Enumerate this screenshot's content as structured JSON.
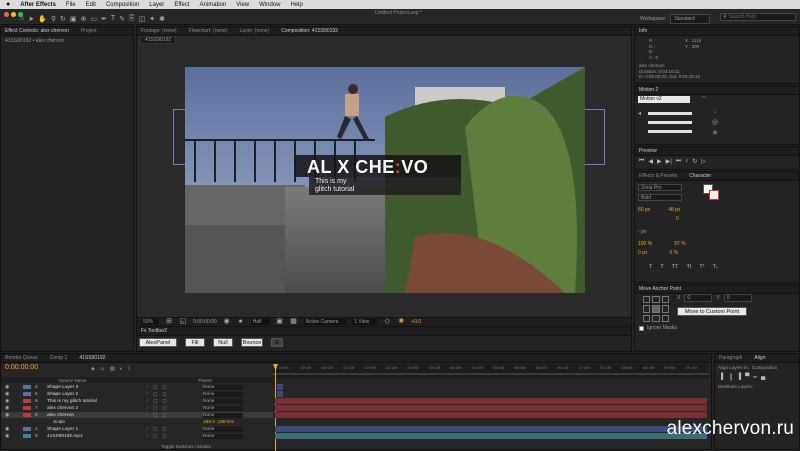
{
  "menubar": {
    "apple": "",
    "app": "After Effects",
    "items": [
      "File",
      "Edit",
      "Composition",
      "Layer",
      "Effect",
      "Animation",
      "View",
      "Window",
      "Help"
    ],
    "doc_title": "Untitled Project.aep *"
  },
  "toolbar": {
    "workspace_label": "Workspace:",
    "workspace_value": "Standard",
    "search_placeholder": "Search Help"
  },
  "project_panel": {
    "tabs": [
      "Effect Controls: alex chervon",
      "Project"
    ],
    "subtitle": "41SS90192 • alex chervon"
  },
  "viewer_tabs": [
    "Footage: (none)",
    "Flowchart: (none)",
    "Layer: (none)",
    "Composition: 41SS90192"
  ],
  "comp_tab_label": "41SS90192",
  "title_card": {
    "headline_a": "AL",
    "headline_b": "X CHE",
    "headline_c": "VO",
    "sub1": "This is my",
    "sub2": "glitch tutorial"
  },
  "viewer_bar": {
    "zoom": "50%",
    "timecode": "0:00:00:00",
    "resolution": "Half",
    "camera": "Active Camera",
    "views": "1 View",
    "exposure": "+0.0"
  },
  "fxtoolbar": {
    "title": "Fx Toolbar2",
    "buttons": [
      "AlexPanel",
      "Fill",
      "Null",
      "Bounce"
    ]
  },
  "info_panel": {
    "tab": "Info",
    "rgb": [
      "R :",
      "G :",
      "B :",
      "A : 0"
    ],
    "xy": [
      "X : 1116",
      "Y : 308"
    ],
    "layer": "alex chervon",
    "duration": "Duration: 0:03:10:11",
    "inout": "In: 0:00:00:00, Out: 0:03:10:10"
  },
  "motion_panel": {
    "tab": "Motion 2",
    "dropdown": "Motion v2"
  },
  "preview_panel": {
    "tab": "Preview"
  },
  "char_panel": {
    "tabs": [
      "Effects & Presets",
      "Character"
    ],
    "font": "Zona Pro",
    "style": "Bold",
    "size": "60 px",
    "leading": "Auto",
    "kerning": "",
    "tracking": "0",
    "stroke": "- px",
    "vscale": "100 %",
    "hscale": "97 %",
    "baseline": "0 px",
    "tsume": "0 %",
    "size2": "48 px"
  },
  "anchor_panel": {
    "title": "Move Anchor Point",
    "x_label": "X",
    "x_value": "0",
    "y_label": "Y",
    "y_value": "0",
    "button": "Move to Custom Point",
    "checkbox": "Ignore Masks"
  },
  "timeline": {
    "tabs": [
      "Render Queue",
      "Comp 1",
      "41SS90192"
    ],
    "timecode": "0:00:00:00",
    "col_header": "Source Name",
    "parent_header": "Parent",
    "ruler": [
      "0:00s",
      "00:15f",
      "01:00f",
      "01:15f",
      "02:00f",
      "02:15f",
      "03:00f",
      "03:15f",
      "04:00f",
      "04:15f",
      "05:00f",
      "05:15f",
      "06:00f",
      "06:15f",
      "07:00f",
      "07:15f",
      "08:00f",
      "08:15f",
      "09:00f",
      "09:15f"
    ],
    "layers": [
      {
        "num": "4",
        "name": "Shape Layer 3",
        "parent": "None"
      },
      {
        "num": "5",
        "name": "Shape Layer 2",
        "parent": "None"
      },
      {
        "num": "6",
        "name": "This is my  glitch tutorial",
        "parent": "None"
      },
      {
        "num": "7",
        "name": "alex chervon 2",
        "parent": "None"
      },
      {
        "num": "8",
        "name": "alex chervon",
        "parent": "None"
      },
      {
        "num": "",
        "name": "Scale",
        "parent": "188.5 ,188.5%"
      },
      {
        "num": "1",
        "name": "Shape Layer 1",
        "parent": "None"
      },
      {
        "num": "9",
        "name": "41SS90192.mp4",
        "parent": "None"
      }
    ],
    "toggle_label": "Toggle Switches / Modes"
  },
  "align_panel": {
    "tabs": [
      "Paragraph",
      "Align"
    ],
    "align_to_label": "Align Layers to:",
    "align_to_value": "Composition",
    "distribute_label": "Distribute Layers:"
  },
  "watermark": "alexchervon.ru",
  "colors": {
    "accent": "#e8a32b",
    "timecode": "#e8a32b",
    "bar_red": "#7a2f35",
    "bar_blue": "#3b4c7a",
    "bar_teal": "#3a6d78",
    "comp_border": "#7a7dbd"
  }
}
